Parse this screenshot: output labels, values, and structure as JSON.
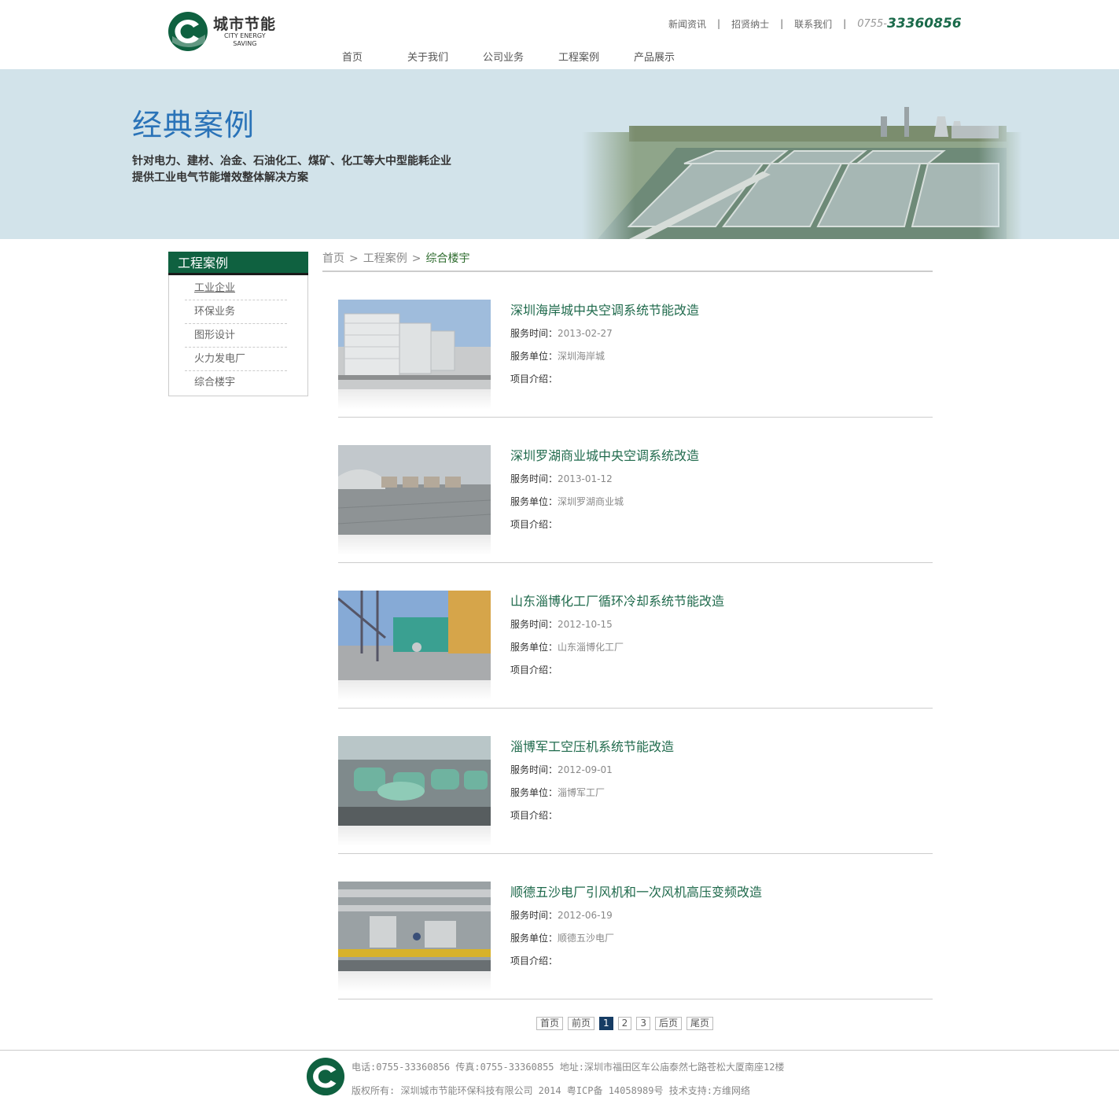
{
  "header": {
    "logo_cn": "城市节能",
    "logo_en_1": "CITY ENERGY",
    "logo_en_2": "SAVING",
    "topnav": [
      "新闻资讯",
      "招贤纳士",
      "联系我们"
    ],
    "phone_prefix": "0755-",
    "phone_main": "33360856",
    "mainnav": [
      "首页",
      "关于我们",
      "公司业务",
      "工程案例",
      "产品展示"
    ]
  },
  "banner": {
    "title": "经典案例",
    "line1": "针对电力、建材、冶金、石油化工、煤矿、化工等大中型能耗企业",
    "line2": "提供工业电气节能增效整体解决方案"
  },
  "sidebar": {
    "head": "工程案例",
    "items": [
      "工业企业",
      "环保业务",
      "图形设计",
      "火力发电厂",
      "综合楼宇"
    ]
  },
  "breadcrumb": {
    "home": "首页",
    "level1": "工程案例",
    "current": "综合楼宇",
    "sep": ">"
  },
  "labels": {
    "time": "服务时间：",
    "unit": "服务单位：",
    "intro": "项目介绍："
  },
  "cases": [
    {
      "title": "深圳海岸城中央空调系统节能改造",
      "time": "2013-02-27",
      "unit": "深圳海岸城",
      "intro": ""
    },
    {
      "title": "深圳罗湖商业城中央空调系统改造",
      "time": "2013-01-12",
      "unit": "深圳罗湖商业城",
      "intro": ""
    },
    {
      "title": "山东淄博化工厂循环冷却系统节能改造",
      "time": "2012-10-15",
      "unit": "山东淄博化工厂",
      "intro": ""
    },
    {
      "title": "淄博军工空压机系统节能改造",
      "time": "2012-09-01",
      "unit": "淄博军工厂",
      "intro": ""
    },
    {
      "title": "顺德五沙电厂引风机和一次风机高压变频改造",
      "time": "2012-06-19",
      "unit": "顺德五沙电厂",
      "intro": ""
    }
  ],
  "pager": {
    "first": "首页",
    "prev": "前页",
    "pages": [
      "1",
      "2",
      "3"
    ],
    "next": "后页",
    "last": "尾页",
    "current": "1"
  },
  "footer": {
    "line1": "电话:0755-33360856 传真:0755-33360855 地址:深圳市福田区车公庙泰然七路苍松大厦南座12楼",
    "line2": "版权所有: 深圳城市节能环保科技有限公司 2014 粤ICP备 14058989号 技术支持:方维网络"
  },
  "colors": {
    "brand_green": "#0f6140",
    "title_blue": "#2a73b8",
    "banner_bg": "#d2e3ea",
    "pager_active": "#163c64"
  }
}
